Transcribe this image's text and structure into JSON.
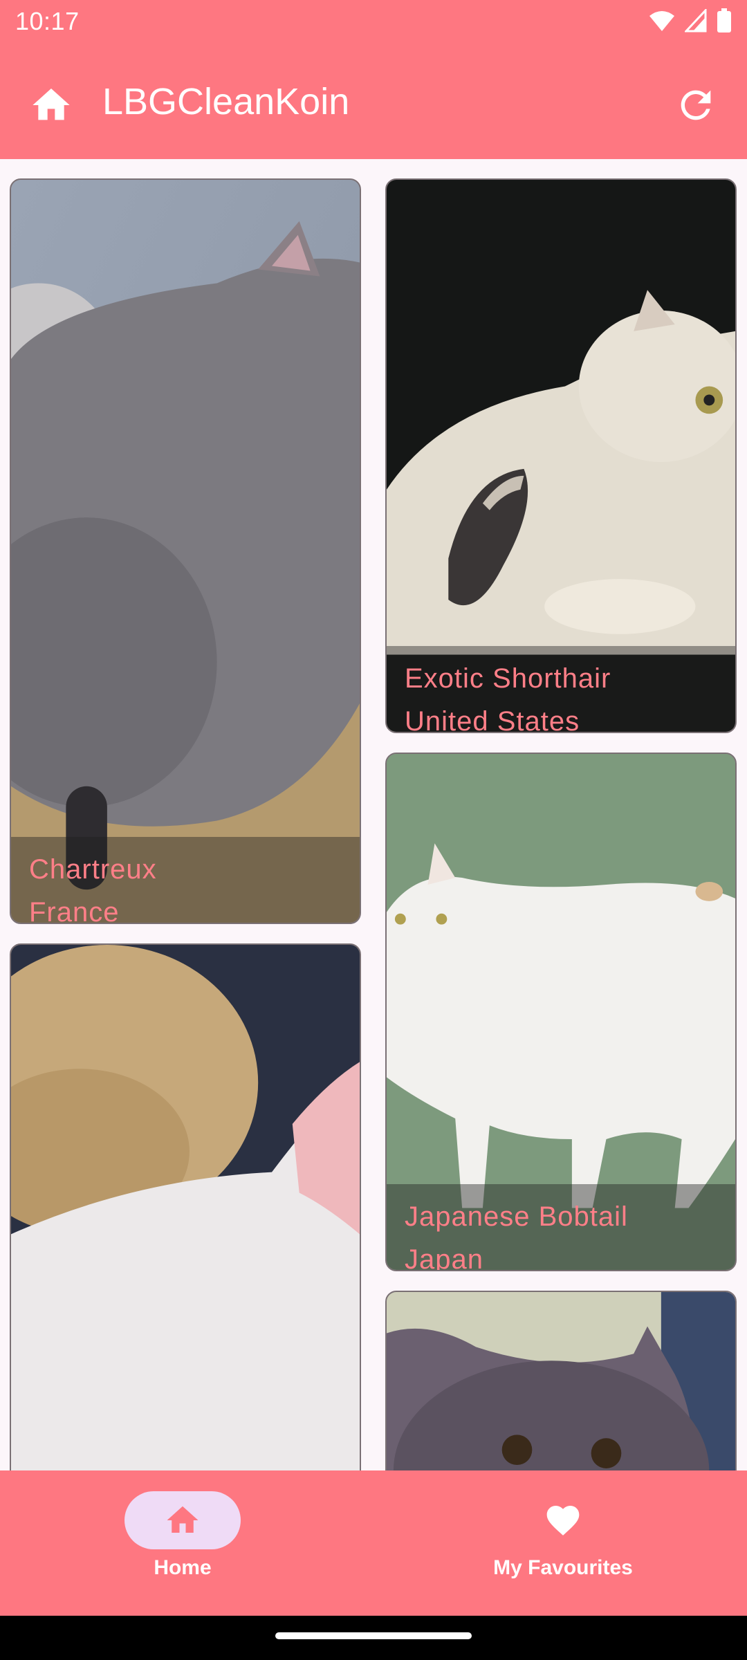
{
  "status_bar": {
    "time": "10:17",
    "icons": [
      "wifi-icon",
      "signal-icon",
      "battery-icon"
    ]
  },
  "app_bar": {
    "title": "LBGCleanKoin",
    "leading_icon": "home-icon",
    "trailing_icon": "refresh-icon"
  },
  "colors": {
    "primary": "#fe7781",
    "caption_text": "#ff7f88",
    "nav_pill": "#efdbf6",
    "background": "#fcf6fa"
  },
  "cards": [
    {
      "breed": "Chartreux",
      "origin": "France"
    },
    {
      "breed": "Exotic Shorthair",
      "origin": "United States"
    },
    {
      "breed": "Japanese Bobtail",
      "origin": "Japan"
    },
    {
      "breed": "",
      "origin": ""
    },
    {
      "breed": "",
      "origin": ""
    }
  ],
  "bottom_nav": {
    "items": [
      {
        "label": "Home",
        "icon": "home-icon",
        "selected": true
      },
      {
        "label": "My Favourites",
        "icon": "heart-icon",
        "selected": false
      }
    ]
  }
}
